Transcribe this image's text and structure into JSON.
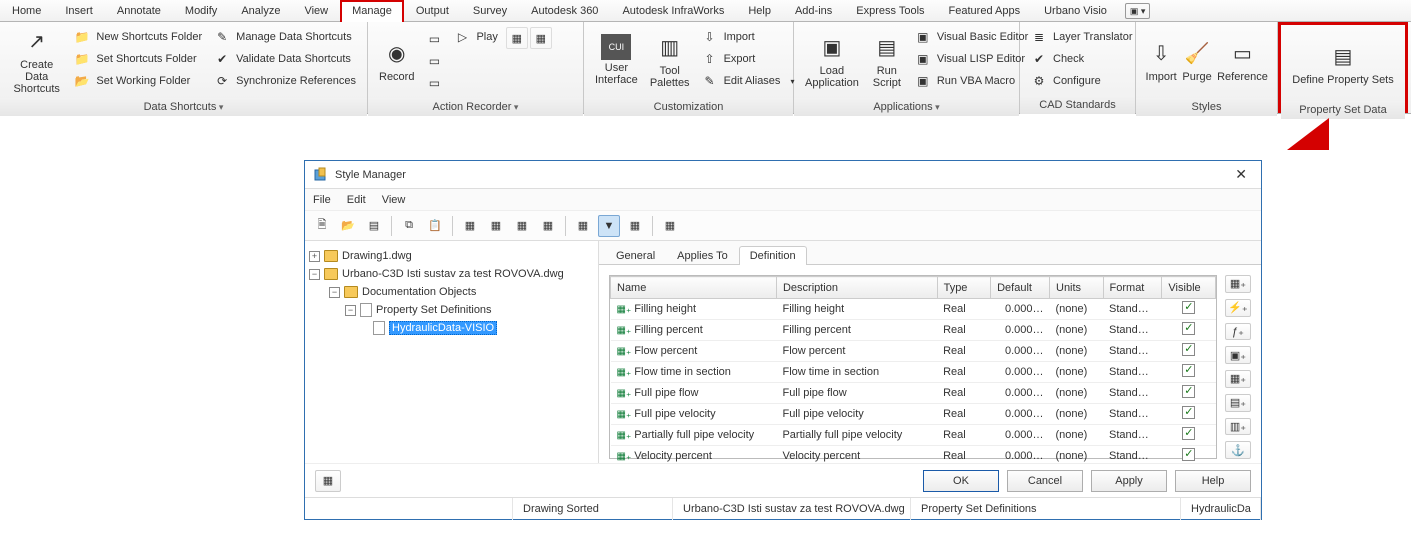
{
  "tabs": [
    "Home",
    "Insert",
    "Annotate",
    "Modify",
    "Analyze",
    "View",
    "Manage",
    "Output",
    "Survey",
    "Autodesk 360",
    "Autodesk InfraWorks",
    "Help",
    "Add-ins",
    "Express Tools",
    "Featured Apps",
    "Urbano Visio"
  ],
  "active_tab": "Manage",
  "panels": {
    "data_shortcuts": {
      "title": "Data Shortcuts",
      "big": "Create Data\nShortcuts",
      "items": [
        "New Shortcuts Folder",
        "Set Shortcuts Folder",
        "Set Working Folder"
      ],
      "items2": [
        "Manage Data Shortcuts",
        "Validate Data Shortcuts",
        "Synchronize References"
      ]
    },
    "action_recorder": {
      "title": "Action Recorder",
      "big": "Record",
      "play": "Play"
    },
    "customization": {
      "title": "Customization",
      "ui": "User\nInterface",
      "tp": "Tool\nPalettes",
      "items": [
        "Import",
        "Export",
        "Edit Aliases"
      ]
    },
    "applications": {
      "title": "Applications",
      "load": "Load\nApplication",
      "run": "Run\nScript",
      "items": [
        "Visual Basic Editor",
        "Visual LISP Editor",
        "Run VBA Macro"
      ]
    },
    "cad": {
      "title": "CAD Standards",
      "items": [
        "Layer Translator",
        "Check",
        "Configure"
      ]
    },
    "styles": {
      "title": "Styles",
      "a": "Import",
      "b": "Purge",
      "c": "Reference"
    },
    "propset": {
      "title": "Property Set Data",
      "big": "Define Property Sets"
    }
  },
  "dialog": {
    "title": "Style Manager",
    "menu": [
      "File",
      "Edit",
      "View"
    ],
    "tree": {
      "n1": "Drawing1.dwg",
      "n2": "Urbano-C3D Isti sustav za test ROVOVA.dwg",
      "n3": "Documentation Objects",
      "n4": "Property Set Definitions",
      "n5": "HydraulicData-VISIO"
    },
    "tabs": [
      "General",
      "Applies To",
      "Definition"
    ],
    "cols": [
      "Name",
      "Description",
      "Type",
      "Default",
      "Units",
      "Format",
      "Visible"
    ],
    "rows": [
      {
        "n": "Filling height",
        "d": "Filling height",
        "t": "Real",
        "def": "0.000…",
        "u": "(none)",
        "f": "Stand…"
      },
      {
        "n": "Filling percent",
        "d": "Filling percent",
        "t": "Real",
        "def": "0.000…",
        "u": "(none)",
        "f": "Stand…"
      },
      {
        "n": "Flow percent",
        "d": "Flow percent",
        "t": "Real",
        "def": "0.000…",
        "u": "(none)",
        "f": "Stand…"
      },
      {
        "n": "Flow time in section",
        "d": "Flow time in section",
        "t": "Real",
        "def": "0.000…",
        "u": "(none)",
        "f": "Stand…"
      },
      {
        "n": "Full pipe flow",
        "d": "Full pipe flow",
        "t": "Real",
        "def": "0.000…",
        "u": "(none)",
        "f": "Stand…"
      },
      {
        "n": "Full pipe velocity",
        "d": "Full pipe velocity",
        "t": "Real",
        "def": "0.000…",
        "u": "(none)",
        "f": "Stand…"
      },
      {
        "n": "Partially full pipe velocity",
        "d": "Partially full pipe velocity",
        "t": "Real",
        "def": "0.000…",
        "u": "(none)",
        "f": "Stand…"
      },
      {
        "n": "Velocity percent",
        "d": "Velocity percent",
        "t": "Real",
        "def": "0.000…",
        "u": "(none)",
        "f": "Stand…"
      }
    ],
    "btns": {
      "ok": "OK",
      "cancel": "Cancel",
      "apply": "Apply",
      "help": "Help"
    },
    "status": {
      "a": "Drawing Sorted",
      "b": "Urbano-C3D Isti sustav za test ROVOVA.dwg",
      "c": "Property Set Definitions",
      "d": "HydraulicDa"
    }
  }
}
